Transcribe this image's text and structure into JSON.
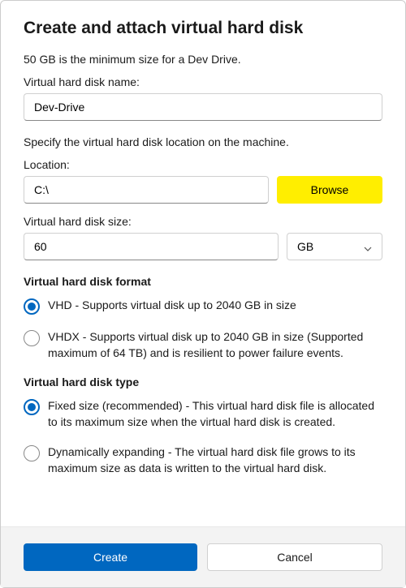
{
  "title": "Create and attach virtual hard disk",
  "subtitle": "50 GB is the minimum size for a Dev Drive.",
  "name": {
    "label": "Virtual hard disk name:",
    "value": "Dev-Drive"
  },
  "location": {
    "instruction": "Specify the virtual hard disk location on the machine.",
    "label": "Location:",
    "value": "C:\\",
    "browse_label": "Browse"
  },
  "size": {
    "label": "Virtual hard disk size:",
    "value": "60",
    "unit": "GB"
  },
  "format": {
    "heading": "Virtual hard disk format",
    "vhd": "VHD - Supports virtual disk up to 2040 GB in size",
    "vhdx": "VHDX - Supports virtual disk up to 2040 GB in size (Supported maximum of 64 TB) and is resilient to power failure events."
  },
  "type": {
    "heading": "Virtual hard disk type",
    "fixed": "Fixed size (recommended) - This virtual hard disk file is allocated to its maximum size when the virtual hard disk is created.",
    "dynamic": "Dynamically expanding - The virtual hard disk file grows to its maximum size as data is written to the virtual hard disk."
  },
  "footer": {
    "create": "Create",
    "cancel": "Cancel"
  }
}
